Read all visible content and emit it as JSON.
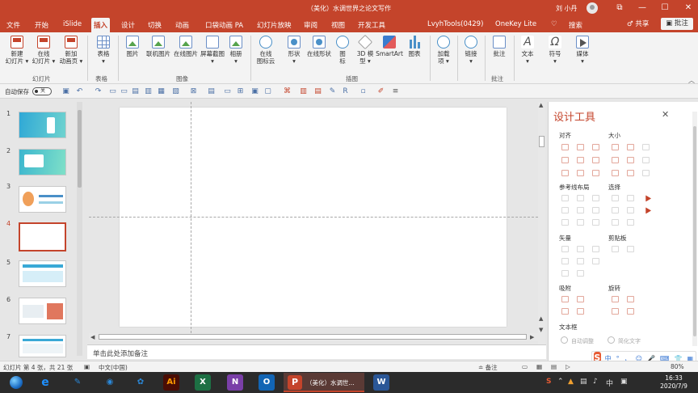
{
  "window": {
    "title": "（美化）水调世界之论文写作",
    "user": "刘 小丹",
    "controls": [
      "⧉",
      "—",
      "☐",
      "✕"
    ]
  },
  "menu": {
    "tabs": [
      "文件",
      "开始",
      "iSlide",
      "插入",
      "设计",
      "切换",
      "动画",
      "口袋动画 PA",
      "幻灯片放映",
      "审阅",
      "视图",
      "开发工具",
      "LvyhTools(0429)",
      "OneKey Lite",
      "♡",
      "搜索"
    ],
    "active": "插入",
    "share": "♂ 共享",
    "annotate": "▣ 批注"
  },
  "ribbon": {
    "buttons": [
      {
        "label": "新建\n幻灯片 ▾",
        "icon": "new-slide-icon"
      },
      {
        "label": "在线\n幻灯片 ▾",
        "icon": "online-slide-icon"
      },
      {
        "label": "新加\n动画页 ▾",
        "icon": "anim-page-icon"
      },
      {
        "label": "表格\n▾",
        "icon": "table-icon"
      },
      {
        "label": "图片",
        "icon": "picture-icon"
      },
      {
        "label": "联机图片",
        "icon": "online-picture-icon"
      },
      {
        "label": "在线图片",
        "icon": "web-picture-icon"
      },
      {
        "label": "屏幕截图\n▾",
        "icon": "screenshot-icon"
      },
      {
        "label": "相册\n▾",
        "icon": "album-icon"
      },
      {
        "label": "在线\n图标云",
        "icon": "icon-cloud-icon"
      },
      {
        "label": "形状\n▾",
        "icon": "shape-icon"
      },
      {
        "label": "在线形状",
        "icon": "online-shape-icon"
      },
      {
        "label": "图\n标",
        "icon": "icons-icon"
      },
      {
        "label": "3D 模\n型 ▾",
        "icon": "model-3d-icon"
      },
      {
        "label": "SmartArt",
        "icon": "smartart-icon"
      },
      {
        "label": "图表",
        "icon": "chart-icon"
      },
      {
        "label": "加载\n项 ▾",
        "icon": "addin-icon"
      },
      {
        "label": "链接\n▾",
        "icon": "link-icon"
      },
      {
        "label": "批注",
        "icon": "comment-icon"
      },
      {
        "label": "文本\n▾",
        "icon": "text-icon"
      },
      {
        "label": "符号\n▾",
        "icon": "symbol-icon"
      },
      {
        "label": "媒体\n▾",
        "icon": "media-icon"
      }
    ],
    "groups": [
      "幻灯片",
      "表格",
      "图像",
      "插图",
      "批注"
    ]
  },
  "qat": {
    "autosave_label": "自动保存",
    "autosave_state": "关"
  },
  "slides": {
    "numbers": [
      "1",
      "2",
      "3",
      "4",
      "5",
      "6",
      "7"
    ],
    "selected": "4"
  },
  "notes": {
    "placeholder": "单击此处添加备注"
  },
  "design_panel": {
    "title": "设计工具",
    "close": "✕",
    "sections": [
      "对齐",
      "大小",
      "参考线布局",
      "选择",
      "矢量",
      "剪贴板",
      "吸附",
      "旋转",
      "文本框"
    ],
    "radio_a": "自动调整",
    "radio_b": "简化文字"
  },
  "status": {
    "slide_info": "幻灯片 第 4 张，共 21 张",
    "language": "中文(中国)",
    "notes_btn": "≐ 备注",
    "zoom": "80%"
  },
  "ime": {
    "logo": "S",
    "items": [
      "中",
      "°",
      "，",
      "☺",
      "🎤",
      "⌨",
      "👕",
      "▦"
    ]
  },
  "taskbar": {
    "apps": [
      {
        "name": "edge",
        "label": "e",
        "color": "#1e90ff"
      },
      {
        "name": "cortana",
        "label": "◉",
        "color": "#2b88d8"
      },
      {
        "name": "paint",
        "label": "✎",
        "color": "#2b88d8"
      },
      {
        "name": "illustrator",
        "label": "Ai",
        "color": "#4a0d05"
      },
      {
        "name": "excel",
        "label": "X",
        "color": "#1d7044"
      },
      {
        "name": "onenote",
        "label": "N",
        "color": "#7a3fa8"
      },
      {
        "name": "outlook",
        "label": "O",
        "color": "#1265b4"
      },
      {
        "name": "word",
        "label": "W",
        "color": "#2b5797"
      }
    ],
    "ppt_label": "（美化）水调世...",
    "tray": [
      "S",
      "⌃",
      "▲",
      "▤",
      "♪",
      "中",
      "▣"
    ],
    "time": "16:33",
    "date": "2020/7/9"
  }
}
